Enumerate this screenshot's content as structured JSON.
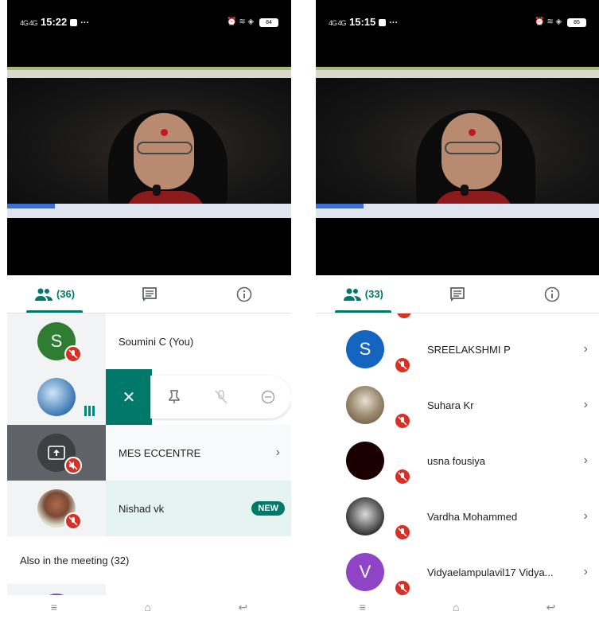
{
  "left": {
    "status": {
      "signal": "4G 4G",
      "time": "15:22",
      "dots": "···",
      "battery": "84"
    },
    "tabs": {
      "people_count": "(36)"
    },
    "rows": [
      {
        "name": "Soumini C (You)",
        "avatar_letter": "S",
        "avatar_color": "#2e7d32"
      },
      {
        "name": "",
        "avatar_letter": "",
        "avatar_color": "#4a90c8"
      },
      {
        "name": "MES ECCENTRE",
        "avatar_letter": "",
        "avatar_color": "#3c4043"
      },
      {
        "name": "Nishad vk",
        "avatar_letter": "",
        "avatar_color": "#c8d6c0",
        "badge": "NEW"
      }
    ],
    "section": "Also in the meeting (32)"
  },
  "right": {
    "status": {
      "signal": "4G 4G",
      "time": "15:15",
      "dots": "···",
      "battery": "85"
    },
    "tabs": {
      "people_count": "(33)"
    },
    "rows": [
      {
        "name": "SREELAKSHMI P",
        "avatar_letter": "S",
        "avatar_color": "#1565c0"
      },
      {
        "name": "Suhara Kr",
        "avatar_letter": "",
        "avatar_color": "#b3a590"
      },
      {
        "name": "usna fousiya",
        "avatar_letter": "",
        "avatar_color": "#1a0000"
      },
      {
        "name": "Vardha Mohammed",
        "avatar_letter": "",
        "avatar_color": "#6b6b6b"
      },
      {
        "name": "Vidyaelampulavil17 Vidya...",
        "avatar_letter": "V",
        "avatar_color": "#8e44c4"
      }
    ]
  },
  "colors": {
    "accent": "#00796b",
    "muted_badge": "#d93025"
  }
}
